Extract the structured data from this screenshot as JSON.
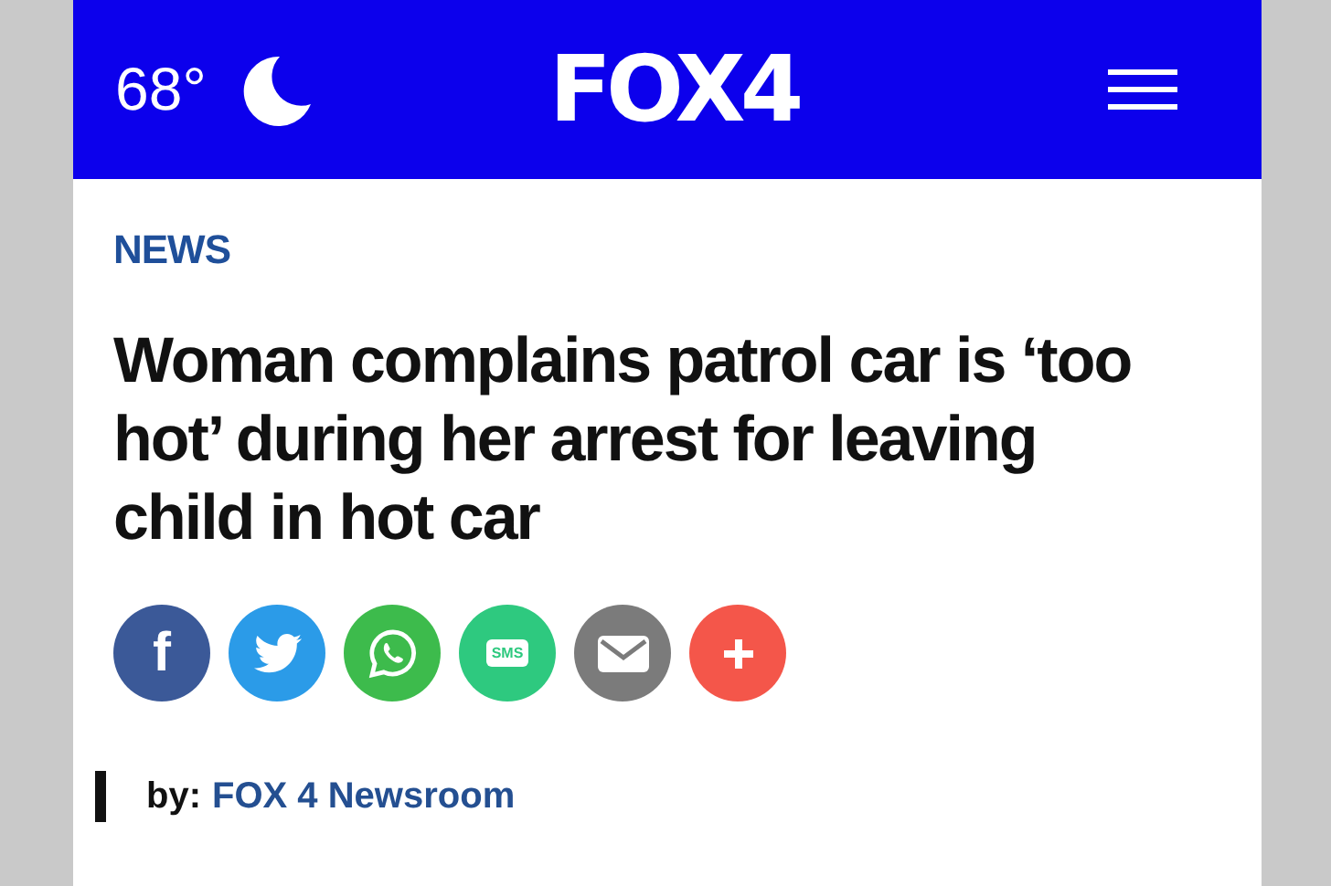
{
  "header": {
    "temperature": "68°",
    "logo": "FOX4"
  },
  "article": {
    "section": "NEWS",
    "headline": "Woman complains patrol car is ‘too hot’ during her arrest for leaving child in hot car",
    "share_buttons": [
      {
        "kind": "facebook",
        "color": "#3b5998",
        "label": "f"
      },
      {
        "kind": "twitter",
        "color": "#2b9be8"
      },
      {
        "kind": "whatsapp",
        "color": "#3dbb4c"
      },
      {
        "kind": "sms",
        "color": "#2ec97f",
        "label": "SMS"
      },
      {
        "kind": "email",
        "color": "#7b7b7b"
      },
      {
        "kind": "more",
        "color": "#f4564a"
      }
    ],
    "byline": {
      "prefix": "by:",
      "author": "FOX 4 Newsroom"
    }
  }
}
